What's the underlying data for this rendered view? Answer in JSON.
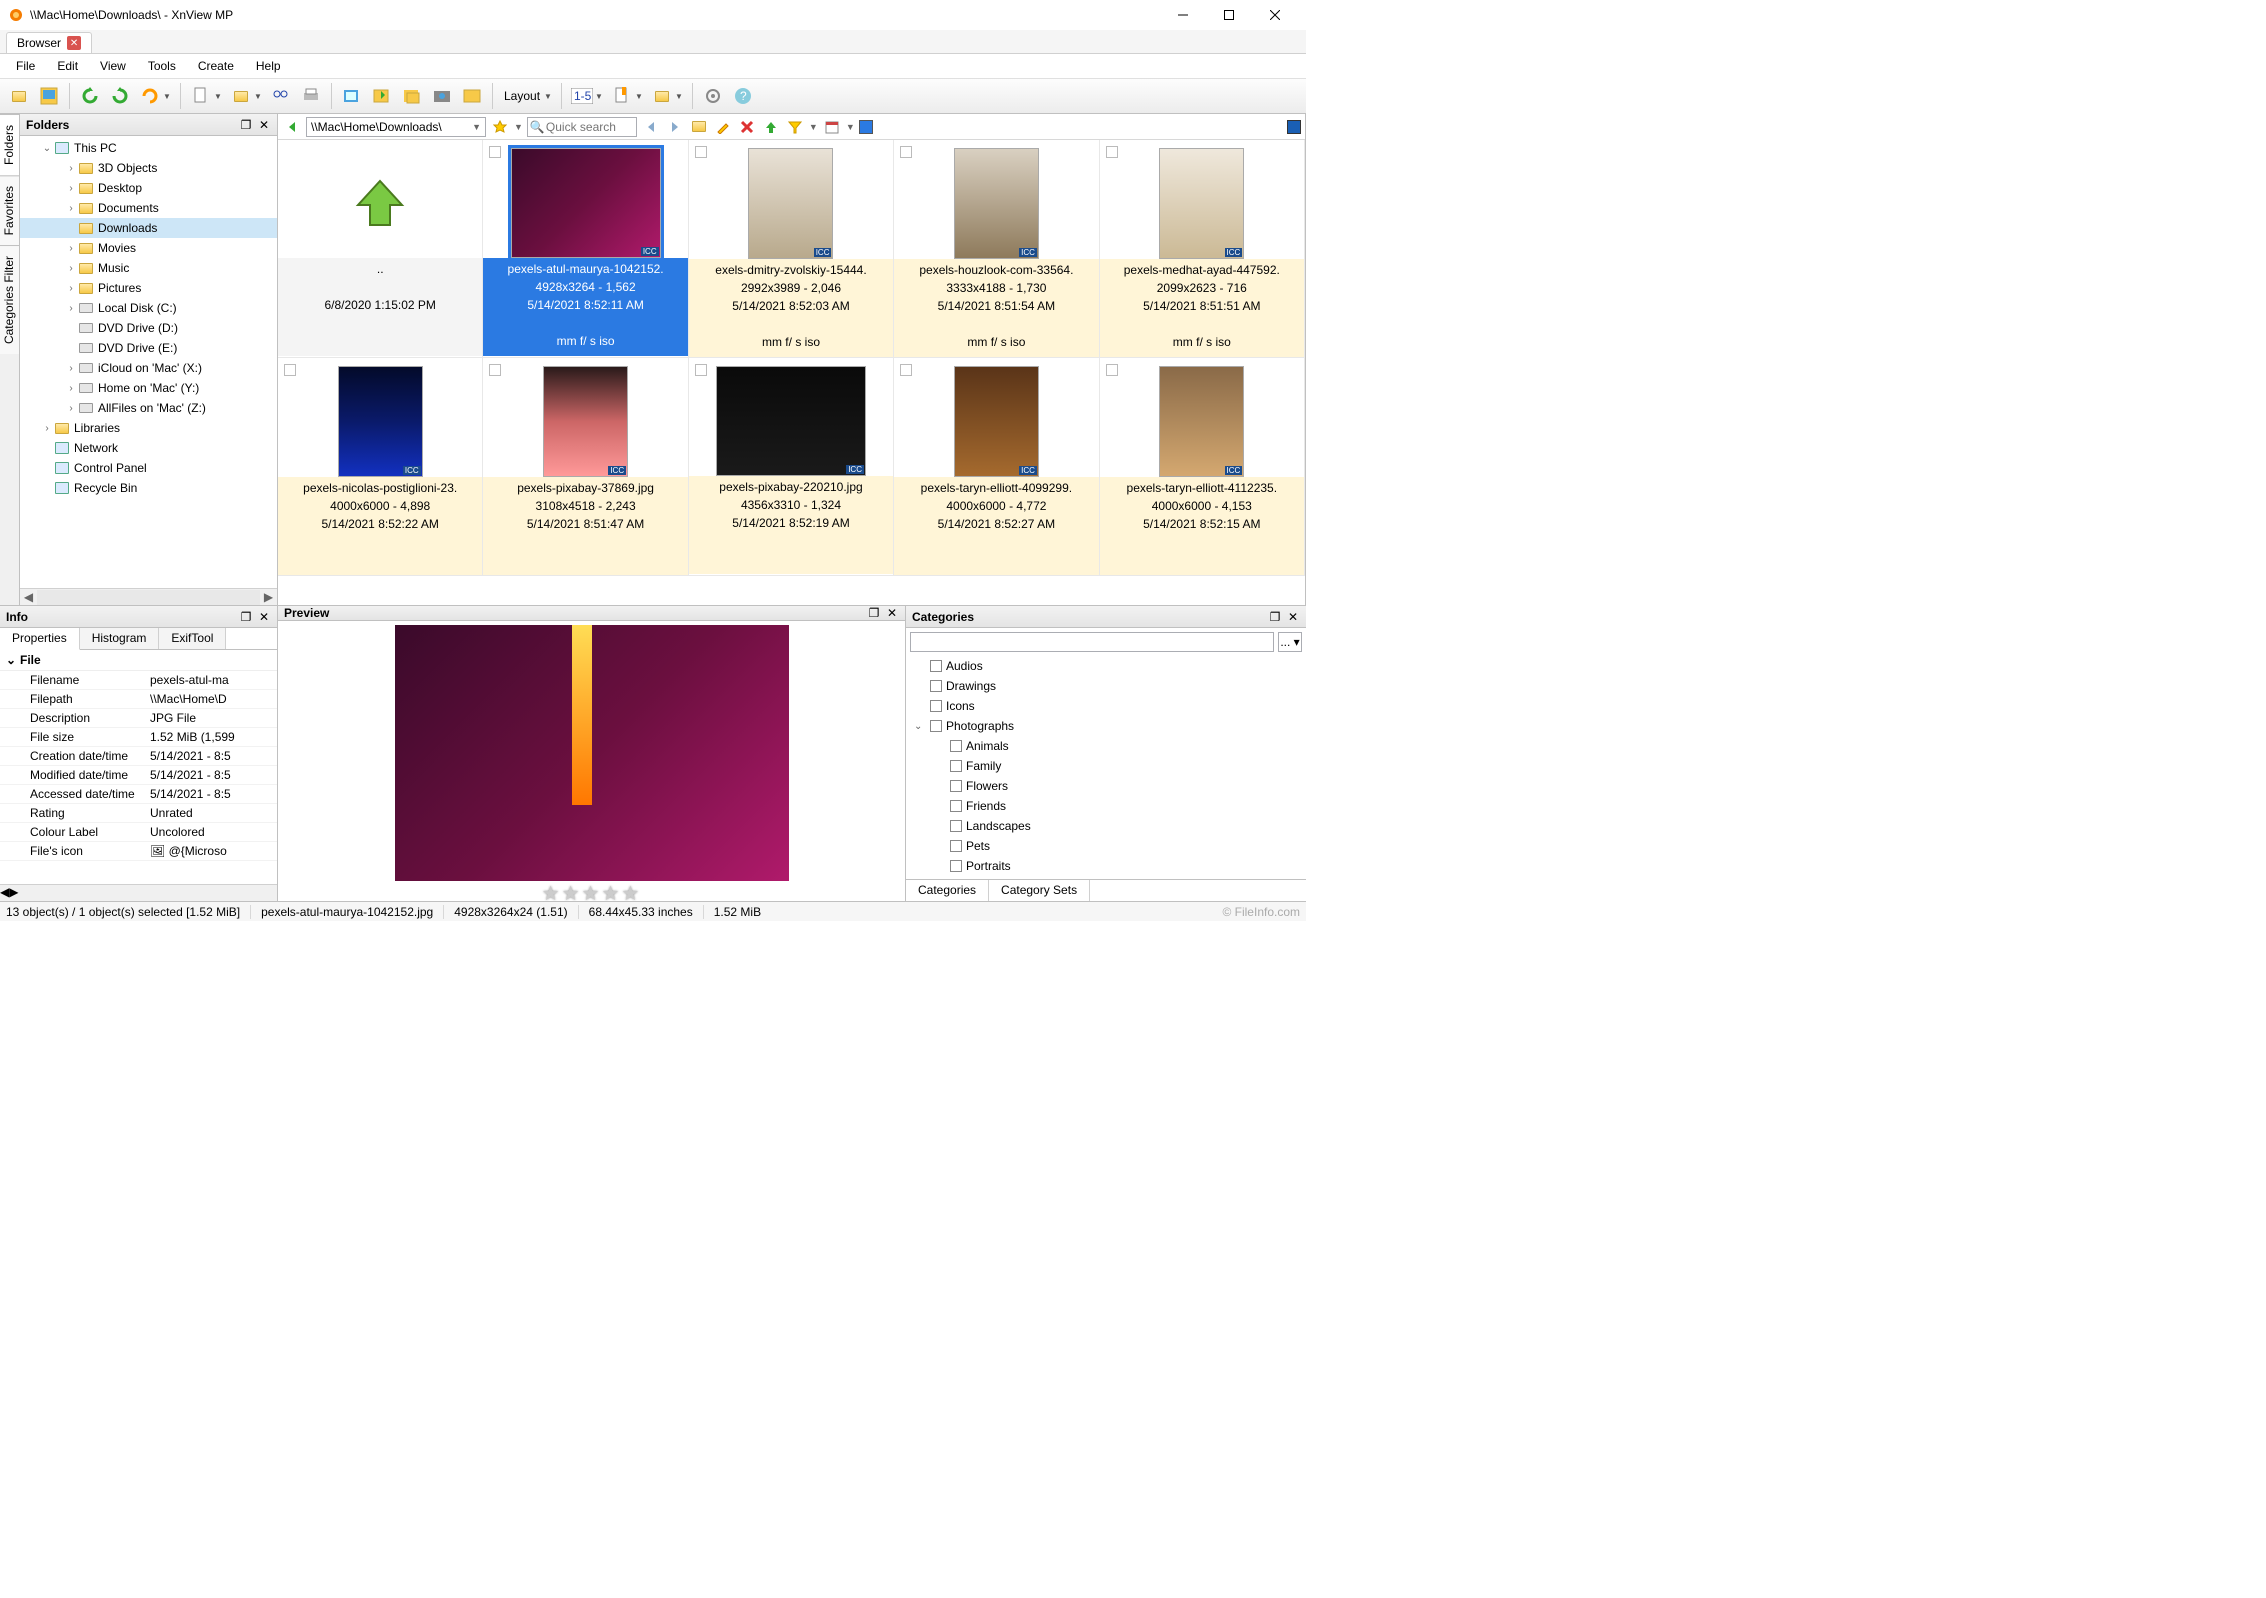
{
  "window": {
    "title": "\\\\Mac\\Home\\Downloads\\ - XnView MP"
  },
  "tab": {
    "label": "Browser"
  },
  "menu": [
    "File",
    "Edit",
    "View",
    "Tools",
    "Create",
    "Help"
  ],
  "toolbar": {
    "layout_label": "Layout"
  },
  "vtabs": [
    "Folders",
    "Favorites",
    "Categories Filter"
  ],
  "folders_panel": {
    "title": "Folders"
  },
  "tree": [
    {
      "label": "This PC",
      "depth": 1,
      "expandable": true,
      "expanded": true,
      "icon": "pc"
    },
    {
      "label": "3D Objects",
      "depth": 2,
      "expandable": true,
      "icon": "folder"
    },
    {
      "label": "Desktop",
      "depth": 2,
      "expandable": true,
      "icon": "folder"
    },
    {
      "label": "Documents",
      "depth": 2,
      "expandable": true,
      "icon": "folder"
    },
    {
      "label": "Downloads",
      "depth": 2,
      "expandable": false,
      "selected": true,
      "icon": "folder"
    },
    {
      "label": "Movies",
      "depth": 2,
      "expandable": true,
      "icon": "folder"
    },
    {
      "label": "Music",
      "depth": 2,
      "expandable": true,
      "icon": "folder"
    },
    {
      "label": "Pictures",
      "depth": 2,
      "expandable": true,
      "icon": "folder"
    },
    {
      "label": "Local Disk (C:)",
      "depth": 2,
      "expandable": true,
      "icon": "drive"
    },
    {
      "label": "DVD Drive (D:)",
      "depth": 2,
      "expandable": false,
      "icon": "drive"
    },
    {
      "label": "DVD Drive (E:)",
      "depth": 2,
      "expandable": false,
      "icon": "drive"
    },
    {
      "label": "iCloud on 'Mac' (X:)",
      "depth": 2,
      "expandable": true,
      "icon": "drive"
    },
    {
      "label": "Home on 'Mac' (Y:)",
      "depth": 2,
      "expandable": true,
      "icon": "drive"
    },
    {
      "label": "AllFiles on 'Mac' (Z:)",
      "depth": 2,
      "expandable": true,
      "icon": "drive"
    },
    {
      "label": "Libraries",
      "depth": 1,
      "expandable": true,
      "icon": "folder"
    },
    {
      "label": "Network",
      "depth": 1,
      "expandable": false,
      "icon": "pc"
    },
    {
      "label": "Control Panel",
      "depth": 1,
      "expandable": false,
      "icon": "pc"
    },
    {
      "label": "Recycle Bin",
      "depth": 1,
      "expandable": false,
      "icon": "pc"
    }
  ],
  "address": {
    "path": "\\\\Mac\\Home\\Downloads\\",
    "search_placeholder": "Quick search"
  },
  "thumbs": [
    {
      "up": true,
      "name": "..",
      "dim": "",
      "date": "6/8/2020 1:15:02 PM",
      "exif": ""
    },
    {
      "name": "pexels-atul-maurya-1042152.",
      "dim": "4928x3264 - 1,562",
      "date": "5/14/2021 8:52:11 AM",
      "exif": "mm f/ s iso",
      "selected": true,
      "portrait": false,
      "bg": "linear-gradient(135deg,#3a0a2a,#6b0f3f,#b01a6b)"
    },
    {
      "name": "exels-dmitry-zvolskiy-15444.",
      "dim": "2992x3989 - 2,046",
      "date": "5/14/2021 8:52:03 AM",
      "exif": "mm f/ s iso",
      "portrait": true,
      "bg": "linear-gradient(#e9e2d7,#b8a98c)"
    },
    {
      "name": "pexels-houzlook-com-33564.",
      "dim": "3333x4188 - 1,730",
      "date": "5/14/2021 8:51:54 AM",
      "exif": "mm f/ s iso",
      "portrait": true,
      "bg": "linear-gradient(#d9d0c1,#8e7a5b)"
    },
    {
      "name": "pexels-medhat-ayad-447592.",
      "dim": "2099x2623 - 716",
      "date": "5/14/2021 8:51:51 AM",
      "exif": "mm f/ s iso",
      "portrait": true,
      "bg": "linear-gradient(#efe8dc,#cbb995)"
    },
    {
      "name": "pexels-nicolas-postiglioni-23.",
      "dim": "4000x6000 - 4,898",
      "date": "5/14/2021 8:52:22 AM",
      "exif": "",
      "portrait": true,
      "bg": "linear-gradient(#030a2a,#0a1a6a,#1230c0)"
    },
    {
      "name": "pexels-pixabay-37869.jpg",
      "dim": "3108x4518 - 2,243",
      "date": "5/14/2021 8:51:47 AM",
      "exif": "",
      "portrait": true,
      "bg": "linear-gradient(#2a1a1a,#c66,#f99)"
    },
    {
      "name": "pexels-pixabay-220210.jpg",
      "dim": "4356x3310 - 1,324",
      "date": "5/14/2021 8:52:19 AM",
      "exif": "",
      "portrait": false,
      "bg": "linear-gradient(#0a0a0a,#1a1a1a)"
    },
    {
      "name": "pexels-taryn-elliott-4099299.",
      "dim": "4000x6000 - 4,772",
      "date": "5/14/2021 8:52:27 AM",
      "exif": "",
      "portrait": true,
      "bg": "linear-gradient(#5a3418,#a56a2e)"
    },
    {
      "name": "pexels-taryn-elliott-4112235.",
      "dim": "4000x6000 - 4,153",
      "date": "5/14/2021 8:52:15 AM",
      "exif": "",
      "portrait": true,
      "bg": "linear-gradient(#8a6a48,#d4a870)"
    }
  ],
  "info": {
    "title": "Info",
    "tabs": [
      "Properties",
      "Histogram",
      "ExifTool"
    ],
    "group": "File",
    "rows": [
      {
        "k": "Filename",
        "v": "pexels-atul-ma"
      },
      {
        "k": "Filepath",
        "v": "\\\\Mac\\Home\\D"
      },
      {
        "k": "Description",
        "v": "JPG File"
      },
      {
        "k": "File size",
        "v": "1.52 MiB (1,599"
      },
      {
        "k": "Creation date/time",
        "v": "5/14/2021 - 8:5"
      },
      {
        "k": "Modified date/time",
        "v": "5/14/2021 - 8:5"
      },
      {
        "k": "Accessed date/time",
        "v": "5/14/2021 - 8:5"
      },
      {
        "k": "Rating",
        "v": "Unrated"
      },
      {
        "k": "Colour Label",
        "v": "Uncolored"
      },
      {
        "k": "File's icon",
        "v": "🖼 @{Microso"
      }
    ]
  },
  "preview": {
    "title": "Preview"
  },
  "categories": {
    "title": "Categories",
    "items": [
      {
        "label": "Audios",
        "depth": 0
      },
      {
        "label": "Drawings",
        "depth": 0
      },
      {
        "label": "Icons",
        "depth": 0
      },
      {
        "label": "Photographs",
        "depth": 0,
        "expandable": true,
        "expanded": true
      },
      {
        "label": "Animals",
        "depth": 1
      },
      {
        "label": "Family",
        "depth": 1
      },
      {
        "label": "Flowers",
        "depth": 1
      },
      {
        "label": "Friends",
        "depth": 1
      },
      {
        "label": "Landscapes",
        "depth": 1
      },
      {
        "label": "Pets",
        "depth": 1
      },
      {
        "label": "Portraits",
        "depth": 1
      }
    ],
    "tabs": [
      "Categories",
      "Category Sets"
    ]
  },
  "status": {
    "objects": "13 object(s) / 1 object(s) selected [1.52 MiB]",
    "file": "pexels-atul-maurya-1042152.jpg",
    "dims": "4928x3264x24 (1.51)",
    "inches": "68.44x45.33 inches",
    "size": "1.52 MiB",
    "watermark": "© FileInfo.com"
  }
}
